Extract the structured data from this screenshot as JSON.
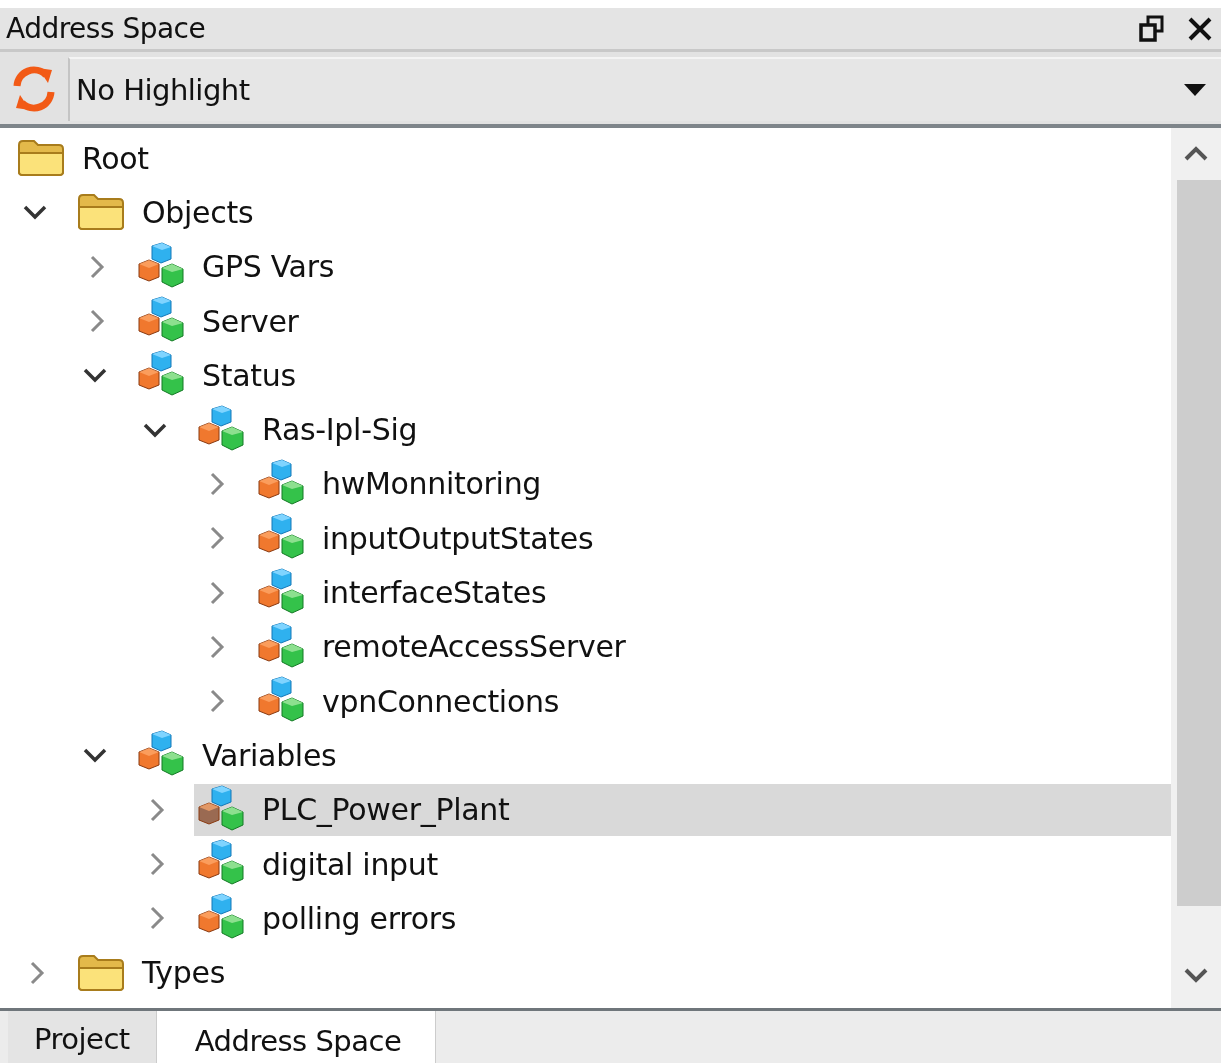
{
  "panel": {
    "title": "Address Space"
  },
  "toolbar": {
    "highlight_combo": {
      "value": "No Highlight"
    }
  },
  "tree": [
    {
      "label": "Root",
      "kind": "folder",
      "selected": false,
      "children": [
        {
          "label": "Objects",
          "kind": "folder",
          "expanded": true,
          "selected": false,
          "children": [
            {
              "label": "GPS Vars",
              "kind": "object",
              "expanded": false,
              "selected": false
            },
            {
              "label": "Server",
              "kind": "object",
              "expanded": false,
              "selected": false
            },
            {
              "label": "Status",
              "kind": "object",
              "expanded": true,
              "selected": false,
              "children": [
                {
                  "label": "Ras-Ipl-Sig",
                  "kind": "object",
                  "expanded": true,
                  "selected": false,
                  "children": [
                    {
                      "label": "hwMonnitoring",
                      "kind": "object",
                      "expanded": false,
                      "selected": false
                    },
                    {
                      "label": "inputOutputStates",
                      "kind": "object",
                      "expanded": false,
                      "selected": false
                    },
                    {
                      "label": "interfaceStates",
                      "kind": "object",
                      "expanded": false,
                      "selected": false
                    },
                    {
                      "label": "remoteAccessServer",
                      "kind": "object",
                      "expanded": false,
                      "selected": false
                    },
                    {
                      "label": "vpnConnections",
                      "kind": "object",
                      "expanded": false,
                      "selected": false
                    }
                  ]
                }
              ]
            },
            {
              "label": "Variables",
              "kind": "object",
              "expanded": true,
              "selected": false,
              "children": [
                {
                  "label": "PLC_Power_Plant",
                  "kind": "device",
                  "expanded": false,
                  "selected": true
                },
                {
                  "label": "digital input",
                  "kind": "object",
                  "expanded": false,
                  "selected": false
                },
                {
                  "label": "polling errors",
                  "kind": "object",
                  "expanded": false,
                  "selected": false
                }
              ]
            }
          ]
        },
        {
          "label": "Types",
          "kind": "folder",
          "expanded": false,
          "selected": false
        }
      ]
    }
  ],
  "tabs": [
    {
      "label": "Project",
      "selected": false
    },
    {
      "label": "Address Space",
      "selected": true
    }
  ]
}
